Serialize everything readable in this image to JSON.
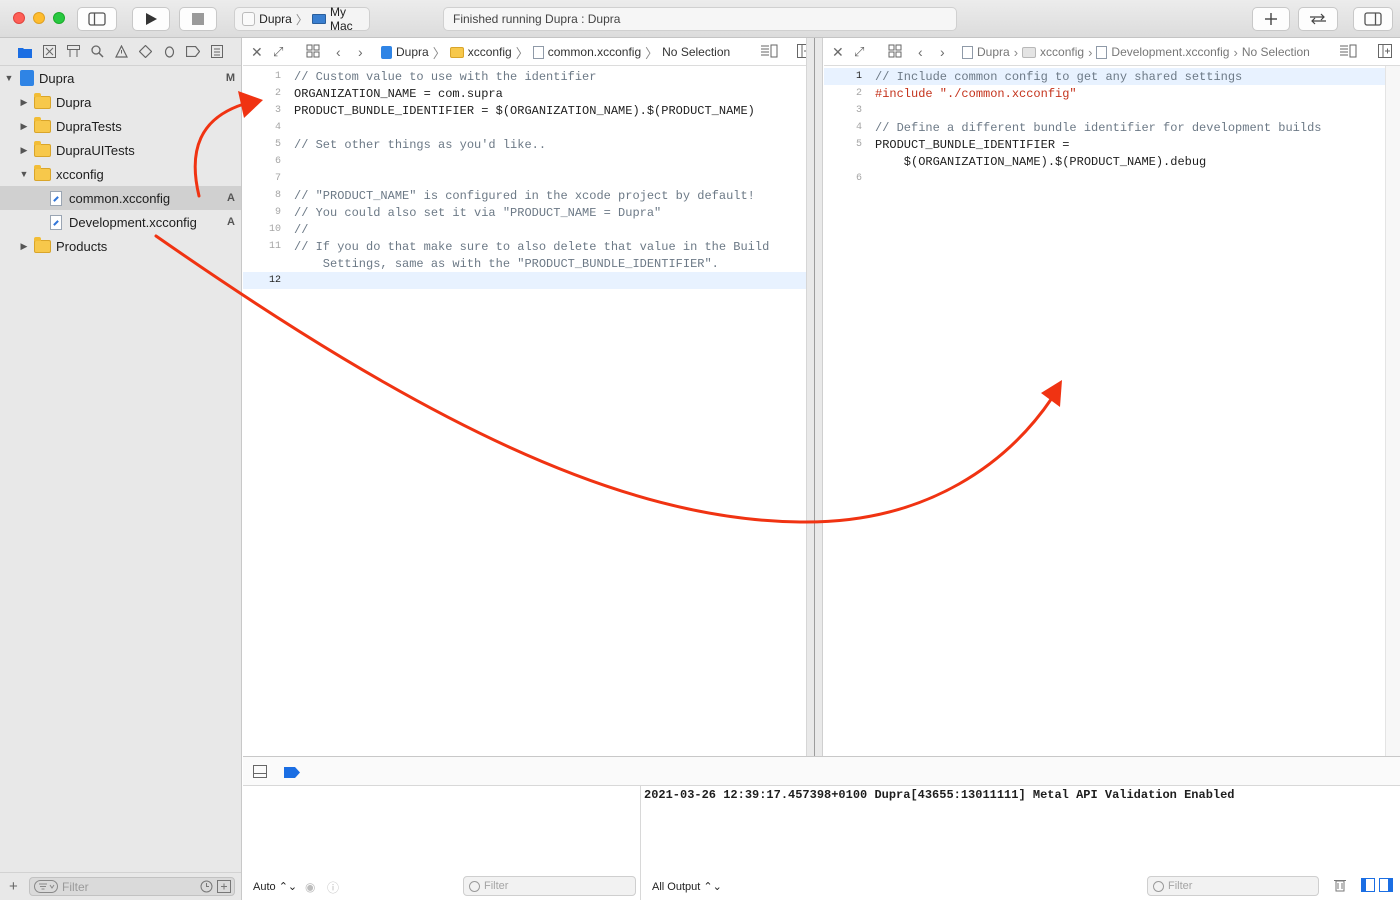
{
  "toolbar": {
    "scheme_target": "Dupra",
    "scheme_device": "My Mac",
    "activity_status": "Finished running Dupra : Dupra"
  },
  "navigator": {
    "items": [
      {
        "label": "Dupra",
        "type": "project",
        "badge": "M",
        "disclosure": "expanded"
      },
      {
        "label": "Dupra",
        "type": "folder",
        "badge": "",
        "disclosure": "collapsed"
      },
      {
        "label": "DupraTests",
        "type": "folder",
        "badge": "",
        "disclosure": "collapsed"
      },
      {
        "label": "DupraUITests",
        "type": "folder",
        "badge": "",
        "disclosure": "collapsed"
      },
      {
        "label": "xcconfig",
        "type": "folder",
        "badge": "",
        "disclosure": "expanded"
      },
      {
        "label": "common.xcconfig",
        "type": "file",
        "badge": "A",
        "selected": true
      },
      {
        "label": "Development.xcconfig",
        "type": "file",
        "badge": "A"
      },
      {
        "label": "Products",
        "type": "folder",
        "badge": "",
        "disclosure": "collapsed"
      }
    ],
    "filter_placeholder": "Filter"
  },
  "left_editor": {
    "crumbs": [
      "Dupra",
      "xcconfig",
      "common.xcconfig",
      "No Selection"
    ],
    "line_numbers": [
      "1",
      "2",
      "3",
      "4",
      "5",
      "6",
      "7",
      "8",
      "9",
      "10",
      "11",
      "",
      "12"
    ],
    "lines": [
      "// Custom value to use with the identifier",
      "ORGANIZATION_NAME = com.supra",
      "PRODUCT_BUNDLE_IDENTIFIER = $(ORGANIZATION_NAME).$(PRODUCT_NAME)",
      "",
      "// Set other things as you'd like..",
      "",
      "",
      "// \"PRODUCT_NAME\" is configured in the xcode project by default!",
      "// You could also set it via \"PRODUCT_NAME = Dupra\"",
      "//",
      "// If you do that make sure to also delete that value in the Build",
      "    Settings, same as with the \"PRODUCT_BUNDLE_IDENTIFIER\".",
      ""
    ]
  },
  "right_editor": {
    "crumbs": [
      "Dupra",
      "xcconfig",
      "Development.xcconfig",
      "No Selection"
    ],
    "line_numbers": [
      "1",
      "2",
      "3",
      "4",
      "5",
      "",
      "6"
    ],
    "lines": [
      "// Include common config to get any shared settings",
      "#include \"./common.xcconfig\"",
      "",
      "// Define a different bundle identifier for development builds",
      "PRODUCT_BUNDLE_IDENTIFIER =",
      "    $(ORGANIZATION_NAME).$(PRODUCT_NAME).debug",
      ""
    ]
  },
  "debug": {
    "variables_scope": "Auto",
    "variables_filter_placeholder": "Filter",
    "console_output_text": "2021-03-26 12:39:17.457398+0100 Dupra[43655:13011111] Metal API Validation Enabled",
    "console_output_mode": "All Output",
    "console_filter_placeholder": "Filter"
  },
  "colors": {
    "annotation_arrow": "#f03312",
    "accent": "#1b6ee3",
    "comment": "#6c7986",
    "preprocessor": "#c4331c"
  }
}
